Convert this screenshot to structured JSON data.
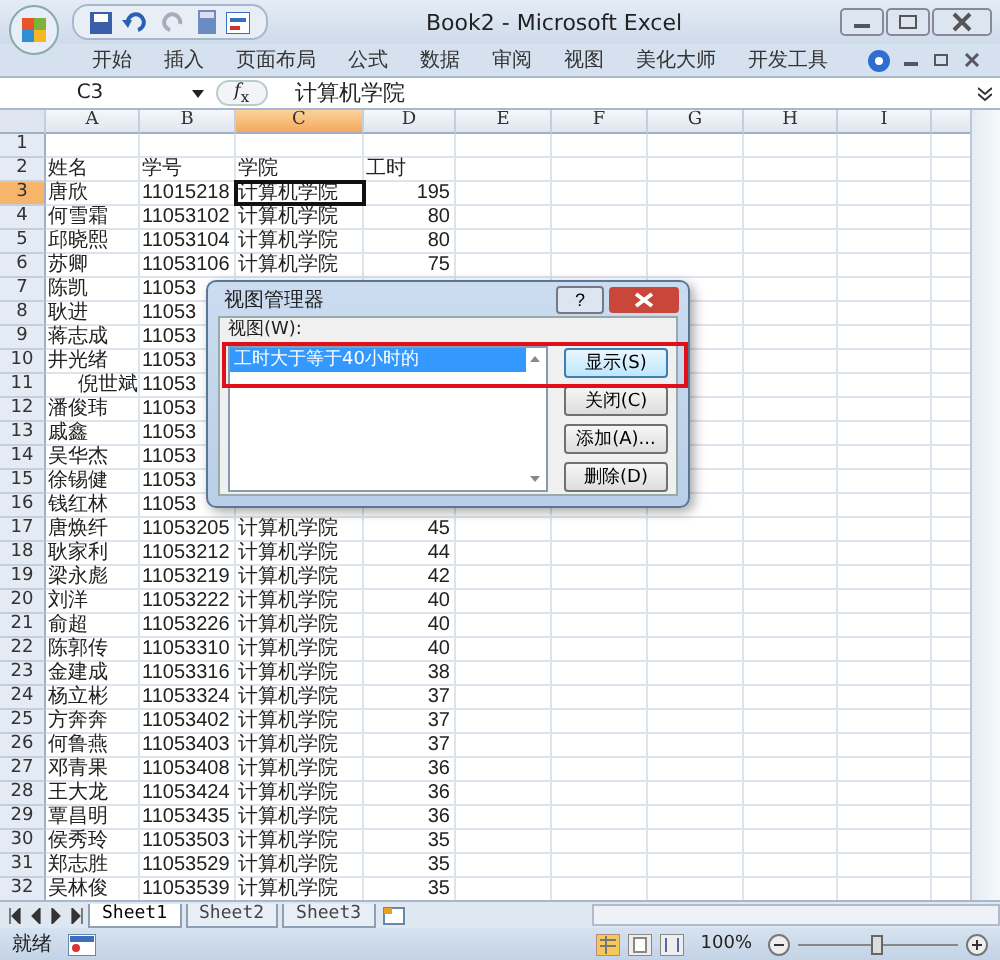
{
  "window": {
    "title": "Book2 - Microsoft Excel"
  },
  "ribbon_tabs": [
    {
      "label": "开始"
    },
    {
      "label": "插入"
    },
    {
      "label": "页面布局"
    },
    {
      "label": "公式"
    },
    {
      "label": "数据"
    },
    {
      "label": "审阅"
    },
    {
      "label": "视图"
    },
    {
      "label": "美化大师"
    },
    {
      "label": "开发工具"
    }
  ],
  "formula_bar": {
    "name_box": "C3",
    "function_label": "*f*$_{x}$",
    "value": "计算机学院"
  },
  "columns": [
    {
      "label": "A",
      "selected": false
    },
    {
      "label": "B",
      "selected": false
    },
    {
      "label": "C",
      "selected": true
    },
    {
      "label": "D",
      "selected": false
    },
    {
      "label": "E",
      "selected": false
    },
    {
      "label": "F",
      "selected": false
    },
    {
      "label": "G",
      "selected": false
    },
    {
      "label": "H",
      "selected": false
    },
    {
      "label": "I",
      "selected": false
    }
  ],
  "rows": [
    {
      "number": "1",
      "selected": false
    },
    {
      "number": "2",
      "selected": false,
      "indented": false,
      "cells": [
        "姓名",
        "学号",
        "学院",
        "工时"
      ]
    },
    {
      "number": "3",
      "selected": true,
      "indented": false,
      "cells": [
        "唐欣",
        "11015218",
        "计算机学院",
        "195"
      ]
    },
    {
      "number": "4",
      "selected": false,
      "indented": false,
      "cells": [
        "何雪霜",
        "11053102",
        "计算机学院",
        "80"
      ]
    },
    {
      "number": "5",
      "selected": false,
      "indented": false,
      "cells": [
        "邱晓熙",
        "11053104",
        "计算机学院",
        "80"
      ]
    },
    {
      "number": "6",
      "selected": false,
      "indented": false,
      "cells": [
        "苏卿",
        "11053106",
        "计算机学院",
        "75"
      ]
    },
    {
      "number": "7",
      "selected": false,
      "indented": false,
      "cells": [
        "陈凯",
        "11053"
      ]
    },
    {
      "number": "8",
      "selected": false,
      "indented": false,
      "cells": [
        "耿进",
        "11053"
      ]
    },
    {
      "number": "9",
      "selected": false,
      "indented": false,
      "cells": [
        "蒋志成",
        "11053"
      ]
    },
    {
      "number": "10",
      "selected": false,
      "indented": false,
      "cells": [
        "井光绪",
        "11053"
      ]
    },
    {
      "number": "11",
      "selected": false,
      "indented": true,
      "cells": [
        "倪世斌",
        "11053"
      ]
    },
    {
      "number": "12",
      "selected": false,
      "indented": false,
      "cells": [
        "潘俊玮",
        "11053"
      ]
    },
    {
      "number": "13",
      "selected": false,
      "indented": false,
      "cells": [
        "戚鑫",
        "11053"
      ]
    },
    {
      "number": "14",
      "selected": false,
      "indented": false,
      "cells": [
        "吴华杰",
        "11053"
      ]
    },
    {
      "number": "15",
      "selected": false,
      "indented": false,
      "cells": [
        "徐锡健",
        "11053"
      ]
    },
    {
      "number": "16",
      "selected": false,
      "indented": false,
      "cells": [
        "钱红林",
        "11053"
      ]
    },
    {
      "number": "17",
      "selected": false,
      "indented": false,
      "cells": [
        "唐焕纤",
        "11053205",
        "计算机学院",
        "45"
      ]
    },
    {
      "number": "18",
      "selected": false,
      "indented": false,
      "cells": [
        "耿家利",
        "11053212",
        "计算机学院",
        "44"
      ]
    },
    {
      "number": "19",
      "selected": false,
      "indented": false,
      "cells": [
        "梁永彪",
        "11053219",
        "计算机学院",
        "42"
      ]
    },
    {
      "number": "20",
      "selected": false,
      "indented": false,
      "cells": [
        "刘洋",
        "11053222",
        "计算机学院",
        "40"
      ]
    },
    {
      "number": "21",
      "selected": false,
      "indented": false,
      "cells": [
        "俞超",
        "11053226",
        "计算机学院",
        "40"
      ]
    },
    {
      "number": "22",
      "selected": false,
      "indented": false,
      "cells": [
        "陈郭传",
        "11053310",
        "计算机学院",
        "40"
      ]
    },
    {
      "number": "23",
      "selected": false,
      "indented": false,
      "cells": [
        "金建成",
        "11053316",
        "计算机学院",
        "38"
      ]
    },
    {
      "number": "24",
      "selected": false,
      "indented": false,
      "cells": [
        "杨立彬",
        "11053324",
        "计算机学院",
        "37"
      ]
    },
    {
      "number": "25",
      "selected": false,
      "indented": false,
      "cells": [
        "方奔奔",
        "11053402",
        "计算机学院",
        "37"
      ]
    },
    {
      "number": "26",
      "selected": false,
      "indented": false,
      "cells": [
        "何鲁燕",
        "11053403",
        "计算机学院",
        "37"
      ]
    },
    {
      "number": "27",
      "selected": false,
      "indented": false,
      "cells": [
        "邓青果",
        "11053408",
        "计算机学院",
        "36"
      ]
    },
    {
      "number": "28",
      "selected": false,
      "indented": false,
      "cells": [
        "王大龙",
        "11053424",
        "计算机学院",
        "36"
      ]
    },
    {
      "number": "29",
      "selected": false,
      "indented": false,
      "cells": [
        "覃昌明",
        "11053435",
        "计算机学院",
        "36"
      ]
    },
    {
      "number": "30",
      "selected": false,
      "indented": false,
      "cells": [
        "侯秀玲",
        "11053503",
        "计算机学院",
        "35"
      ]
    },
    {
      "number": "31",
      "selected": false,
      "indented": false,
      "cells": [
        "郑志胜",
        "11053529",
        "计算机学院",
        "35"
      ]
    },
    {
      "number": "32",
      "selected": false,
      "indented": false,
      "cells": [
        "吴林俊",
        "11053539",
        "计算机学院",
        "35"
      ]
    }
  ],
  "dialog": {
    "title": "视图管理器",
    "help_label": "?",
    "list_label": "视图(W):",
    "views": [
      {
        "label": "工时大于等于40小时的",
        "selected": true
      }
    ],
    "buttons": [
      {
        "label": "显示(S)",
        "default": true
      },
      {
        "label": "关闭(C)",
        "default": false
      },
      {
        "label": "添加(A)...",
        "default": false
      },
      {
        "label": "删除(D)",
        "default": false
      }
    ]
  },
  "sheet_tabs": [
    {
      "label": "Sheet1",
      "selected": true
    },
    {
      "label": "Sheet2",
      "selected": false
    },
    {
      "label": "Sheet3",
      "selected": false
    }
  ],
  "status_bar": {
    "status": "就绪",
    "zoom": "100%",
    "level": 0.5
  }
}
